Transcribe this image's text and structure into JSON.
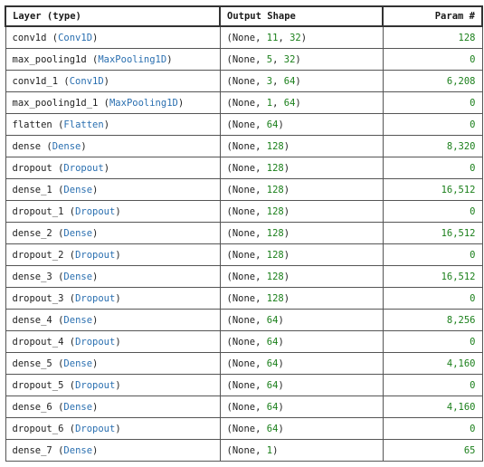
{
  "headers": {
    "layer": "Layer (type)",
    "shape": "Output Shape",
    "params": "Param #"
  },
  "rows": [
    {
      "name": "conv1d",
      "type": "Conv1D",
      "shape": [
        "None",
        "11",
        "32"
      ],
      "params": "128"
    },
    {
      "name": "max_pooling1d",
      "type": "MaxPooling1D",
      "shape": [
        "None",
        "5",
        "32"
      ],
      "params": "0"
    },
    {
      "name": "conv1d_1",
      "type": "Conv1D",
      "shape": [
        "None",
        "3",
        "64"
      ],
      "params": "6,208"
    },
    {
      "name": "max_pooling1d_1",
      "type": "MaxPooling1D",
      "shape": [
        "None",
        "1",
        "64"
      ],
      "params": "0"
    },
    {
      "name": "flatten",
      "type": "Flatten",
      "shape": [
        "None",
        "64"
      ],
      "params": "0"
    },
    {
      "name": "dense",
      "type": "Dense",
      "shape": [
        "None",
        "128"
      ],
      "params": "8,320"
    },
    {
      "name": "dropout",
      "type": "Dropout",
      "shape": [
        "None",
        "128"
      ],
      "params": "0"
    },
    {
      "name": "dense_1",
      "type": "Dense",
      "shape": [
        "None",
        "128"
      ],
      "params": "16,512"
    },
    {
      "name": "dropout_1",
      "type": "Dropout",
      "shape": [
        "None",
        "128"
      ],
      "params": "0"
    },
    {
      "name": "dense_2",
      "type": "Dense",
      "shape": [
        "None",
        "128"
      ],
      "params": "16,512"
    },
    {
      "name": "dropout_2",
      "type": "Dropout",
      "shape": [
        "None",
        "128"
      ],
      "params": "0"
    },
    {
      "name": "dense_3",
      "type": "Dense",
      "shape": [
        "None",
        "128"
      ],
      "params": "16,512"
    },
    {
      "name": "dropout_3",
      "type": "Dropout",
      "shape": [
        "None",
        "128"
      ],
      "params": "0"
    },
    {
      "name": "dense_4",
      "type": "Dense",
      "shape": [
        "None",
        "64"
      ],
      "params": "8,256"
    },
    {
      "name": "dropout_4",
      "type": "Dropout",
      "shape": [
        "None",
        "64"
      ],
      "params": "0"
    },
    {
      "name": "dense_5",
      "type": "Dense",
      "shape": [
        "None",
        "64"
      ],
      "params": "4,160"
    },
    {
      "name": "dropout_5",
      "type": "Dropout",
      "shape": [
        "None",
        "64"
      ],
      "params": "0"
    },
    {
      "name": "dense_6",
      "type": "Dense",
      "shape": [
        "None",
        "64"
      ],
      "params": "4,160"
    },
    {
      "name": "dropout_6",
      "type": "Dropout",
      "shape": [
        "None",
        "64"
      ],
      "params": "0"
    },
    {
      "name": "dense_7",
      "type": "Dense",
      "shape": [
        "None",
        "1"
      ],
      "params": "65"
    }
  ],
  "colors": {
    "type_text": "#2a6fb0",
    "number_text": "#1a7f1a",
    "border": "#555555"
  }
}
